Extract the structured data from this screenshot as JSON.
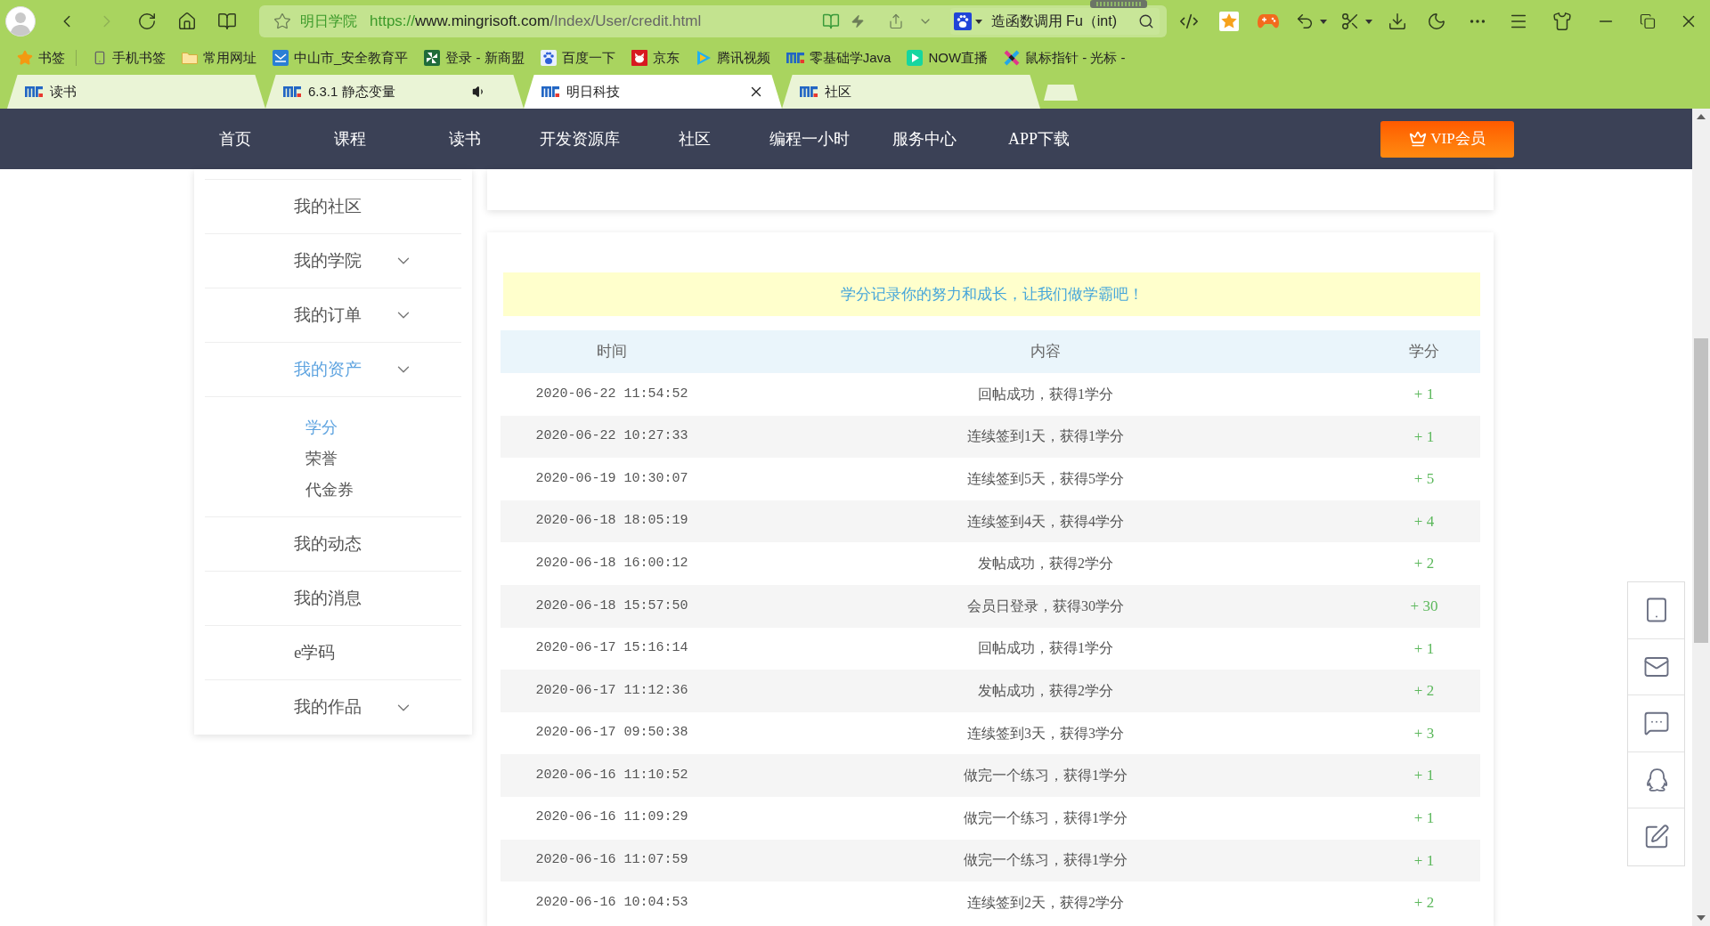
{
  "browser": {
    "address_bar": {
      "site_name": "明日学院",
      "scheme": "https://",
      "host": "www.mingrisoft.com",
      "path": "/Index/User/credit.html"
    },
    "search_field": {
      "value": "造函数调用 Fu（int)"
    },
    "bookmarks": [
      {
        "label": "书签"
      },
      {
        "label": "手机书签"
      },
      {
        "label": "常用网址"
      },
      {
        "label": "中山市_安全教育平"
      },
      {
        "label": "登录 - 新商盟"
      },
      {
        "label": "百度一下"
      },
      {
        "label": "京东"
      },
      {
        "label": "腾讯视频"
      },
      {
        "label": "零基础学Java"
      },
      {
        "label": "NOW直播"
      },
      {
        "label": "鼠标指针 - 光标 -"
      }
    ],
    "tabs": [
      {
        "label": "读书",
        "selected": false,
        "audio": false
      },
      {
        "label": "6.3.1 静态变量",
        "selected": false,
        "audio": true
      },
      {
        "label": "明日科技",
        "selected": true,
        "audio": false
      },
      {
        "label": "社区",
        "selected": false,
        "audio": false
      }
    ]
  },
  "nav": {
    "items": [
      "首页",
      "课程",
      "读书",
      "开发资源库",
      "社区",
      "编程一小时",
      "服务中心",
      "APP下载"
    ],
    "vip_button": "VIP会员"
  },
  "sidebar": {
    "items": [
      {
        "label": "我的社区",
        "kind": "link",
        "selected": false
      },
      {
        "label": "我的学院",
        "kind": "menu",
        "selected": false
      },
      {
        "label": "我的订单",
        "kind": "menu",
        "selected": false
      },
      {
        "label": "我的资产",
        "kind": "menu",
        "selected": true,
        "children": [
          {
            "label": "学分",
            "selected": true
          },
          {
            "label": "荣誉",
            "selected": false
          },
          {
            "label": "代金券",
            "selected": false
          }
        ]
      },
      {
        "label": "我的动态",
        "kind": "link",
        "selected": false
      },
      {
        "label": "我的消息",
        "kind": "link",
        "selected": false
      },
      {
        "label": "e学码",
        "kind": "link",
        "selected": false
      },
      {
        "label": "我的作品",
        "kind": "menu",
        "selected": false
      }
    ]
  },
  "credits": {
    "banner": "学分记录你的努力和成长，让我们做学霸吧！",
    "table": {
      "columns": [
        "时间",
        "内容",
        "学分"
      ],
      "rows": [
        {
          "time": "2020-06-22 11:54:52",
          "content": "回帖成功，获得1学分",
          "credit": "+ 1"
        },
        {
          "time": "2020-06-22 10:27:33",
          "content": "连续签到1天，获得1学分",
          "credit": "+ 1"
        },
        {
          "time": "2020-06-19 10:30:07",
          "content": "连续签到5天，获得5学分",
          "credit": "+ 5"
        },
        {
          "time": "2020-06-18 18:05:19",
          "content": "连续签到4天，获得4学分",
          "credit": "+ 4"
        },
        {
          "time": "2020-06-18 16:00:12",
          "content": "发帖成功，获得2学分",
          "credit": "+ 2"
        },
        {
          "time": "2020-06-18 15:57:50",
          "content": "会员日登录，获得30学分",
          "credit": "+ 30"
        },
        {
          "time": "2020-06-17 15:16:14",
          "content": "回帖成功，获得1学分",
          "credit": "+ 1"
        },
        {
          "time": "2020-06-17 11:12:36",
          "content": "发帖成功，获得2学分",
          "credit": "+ 2"
        },
        {
          "time": "2020-06-17 09:50:38",
          "content": "连续签到3天，获得3学分",
          "credit": "+ 3"
        },
        {
          "time": "2020-06-16 11:10:52",
          "content": "做完一个练习，获得1学分",
          "credit": "+ 1"
        },
        {
          "time": "2020-06-16 11:09:29",
          "content": "做完一个练习，获得1学分",
          "credit": "+ 1"
        },
        {
          "time": "2020-06-16 11:07:59",
          "content": "做完一个练习，获得1学分",
          "credit": "+ 1"
        },
        {
          "time": "2020-06-16 10:04:53",
          "content": "连续签到2天，获得2学分",
          "credit": "+ 2"
        }
      ]
    }
  }
}
